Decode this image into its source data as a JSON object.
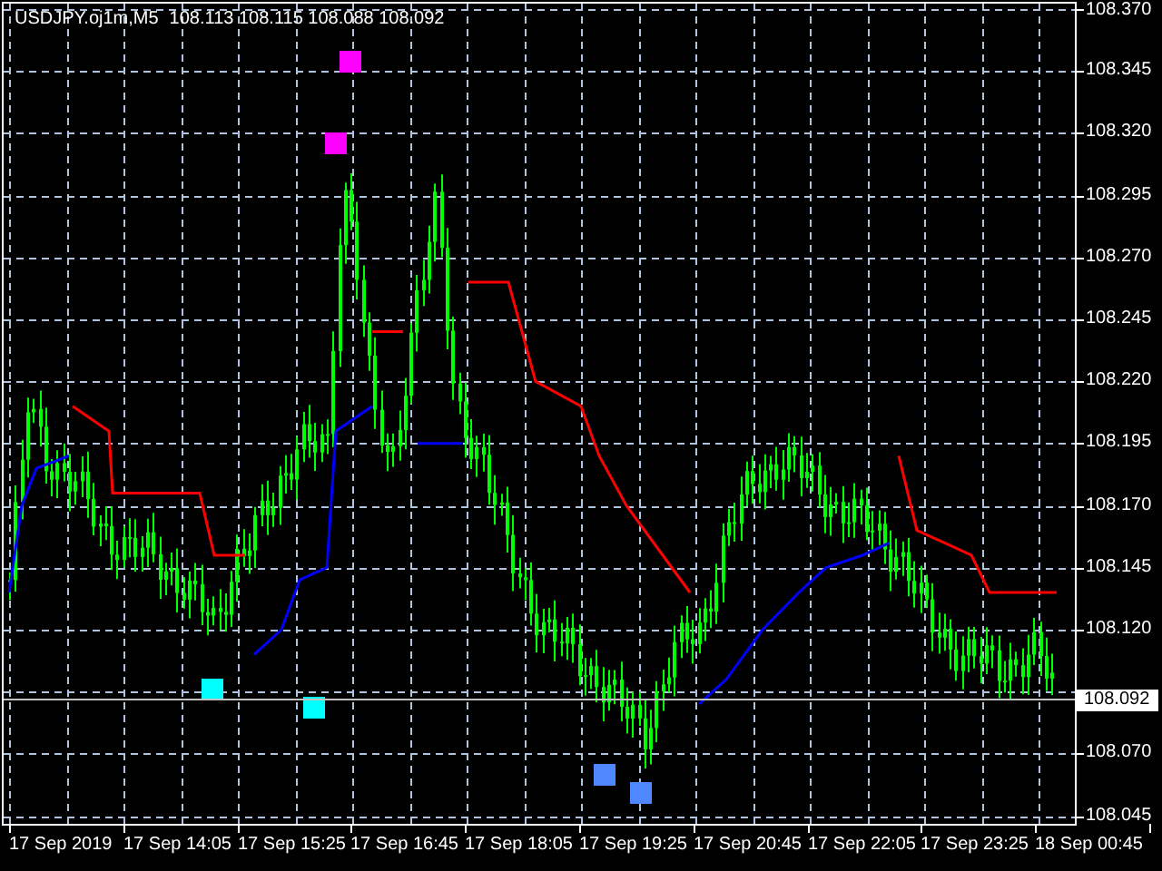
{
  "chart": {
    "symbol": "USDJPY.oj1m,M5",
    "ohlc": "108.113 108.115 108.088 108.092"
  },
  "price_axis": [
    "108.370",
    "108.345",
    "108.320",
    "108.295",
    "108.270",
    "108.245",
    "108.220",
    "108.195",
    "108.170",
    "108.145",
    "108.120",
    "108.070",
    "108.045"
  ],
  "current_price": "108.092",
  "time_axis": [
    "17 Sep 2019",
    "17 Sep 14:05",
    "17 Sep 15:25",
    "17 Sep 16:45",
    "17 Sep 18:05",
    "17 Sep 19:25",
    "17 Sep 20:45",
    "17 Sep 22:05",
    "17 Sep 23:25",
    "18 Sep 00:45"
  ]
}
